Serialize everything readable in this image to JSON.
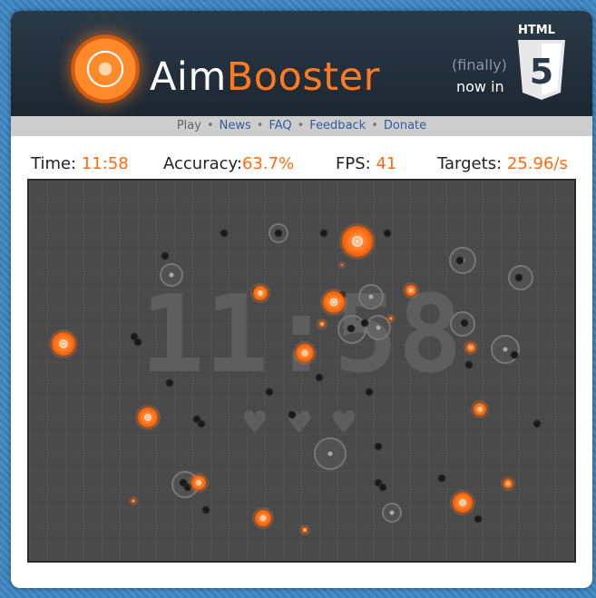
{
  "header": {
    "logo_aim": "Aim",
    "logo_booster": "Booster",
    "html5_label": "HTML",
    "html5_number": "5",
    "finally": "(finally)",
    "now_in": "now in"
  },
  "nav": {
    "items": [
      {
        "label": "Play",
        "active": true
      },
      {
        "label": "News",
        "active": false
      },
      {
        "label": "FAQ",
        "active": false
      },
      {
        "label": "Feedback",
        "active": false
      },
      {
        "label": "Donate",
        "active": false
      }
    ],
    "separator": "•"
  },
  "stats": {
    "time_label": "Time:",
    "time_value": "11:58",
    "accuracy_label": "Accuracy:",
    "accuracy_value": "63.7%",
    "fps_label": "FPS:",
    "fps_value": "41",
    "targets_label": "Targets:",
    "targets_value": "25.96/s"
  },
  "game": {
    "timer_display": "11:58",
    "lives": 3,
    "heart_glyph": "♥",
    "colors": {
      "accent": "#ff6a10",
      "field": "#4a4a4a",
      "grid": "#555555"
    }
  }
}
